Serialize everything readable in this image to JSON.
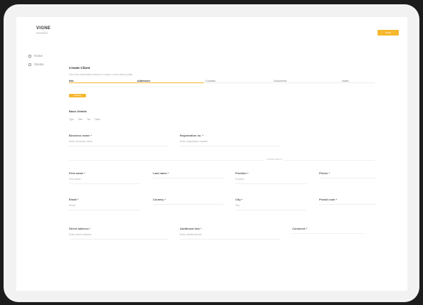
{
  "header": {
    "logo": "VIGNE",
    "button_label": "SAVE"
  },
  "sidebar": {
    "items": [
      {
        "label": "Home",
        "icon": "home-icon"
      },
      {
        "label": "Clients",
        "icon": "users-icon"
      }
    ]
  },
  "main": {
    "title": "Create Client",
    "subtitle": "Fill in the information below to create a new client profile",
    "tabs": [
      {
        "label": "Info",
        "active": true
      },
      {
        "label": "Addresses",
        "active": true
      },
      {
        "label": "Contacts",
        "active": false
      },
      {
        "label": "Documents",
        "active": false
      },
      {
        "label": "Notes",
        "active": false
      }
    ],
    "action_button": "Continue",
    "section_title": "Basic Details",
    "chips": [
      "Type",
      "Size",
      "Tax",
      "Other"
    ],
    "row1": [
      {
        "label": "Business name *",
        "value": "Enter business name"
      },
      {
        "label": "Registration no. *",
        "value": "Enter registration number"
      }
    ],
    "divider_label": "Contact person",
    "row2": [
      {
        "label": "First name *",
        "value": "First name"
      },
      {
        "label": "Last name *",
        "value": ""
      },
      {
        "label": "Position *",
        "value": "Position"
      },
      {
        "label": "Phone *",
        "value": ""
      }
    ],
    "row3": [
      {
        "label": "Email *",
        "value": "Email"
      },
      {
        "label": "Country *",
        "value": ""
      },
      {
        "label": "City *",
        "value": "City"
      },
      {
        "label": "Postal code *",
        "value": ""
      }
    ],
    "row4": [
      {
        "label": "Street address *",
        "value": "Enter street address"
      },
      {
        "label": "Additional info *",
        "value": "Enter additional info"
      },
      {
        "label": "Comment *",
        "value": ""
      }
    ]
  }
}
